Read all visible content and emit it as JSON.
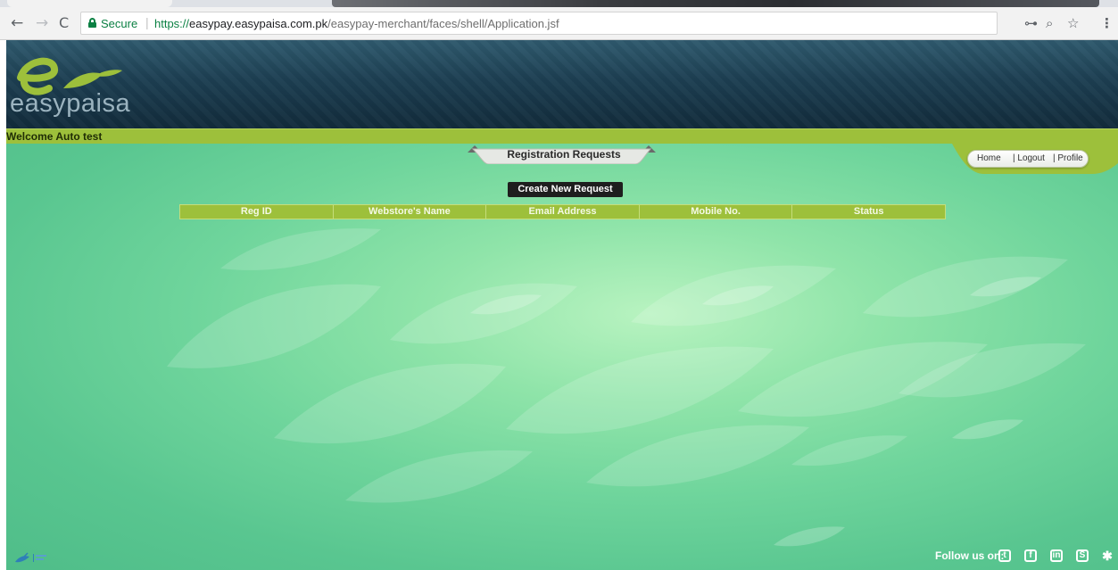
{
  "browser": {
    "nav": {
      "back": "←",
      "forward": "→",
      "reload": "C"
    },
    "security_label": "Secure",
    "url": {
      "protocol": "https://",
      "host": "easypay.easypaisa.com.pk",
      "path": "/easypay-merchant/faces/shell/Application.jsf"
    },
    "icons": [
      "key-icon",
      "zoom-icon",
      "star-icon",
      "menu-icon"
    ]
  },
  "site": {
    "logo_text": "easypaisa",
    "brand_colors": {
      "green": "#9dc03b",
      "navy": "#1d3f52",
      "button": "#1e1e1e"
    }
  },
  "welcome": "Welcome Auto test",
  "tab": {
    "label": "Registration Requests"
  },
  "nav": {
    "home": "Home",
    "logout": "| Logout",
    "profile": "| Profile"
  },
  "create_button": "Create New Request",
  "table": {
    "columns": [
      "Reg ID",
      "Webstore's Name",
      "Email Address",
      "Mobile No.",
      "Status"
    ],
    "rows": []
  },
  "footer": {
    "follow_label": "Follow us on:",
    "social_icons": [
      "twitter-icon",
      "facebook-icon",
      "linkedin-icon",
      "skype-icon",
      "share-icon"
    ]
  }
}
